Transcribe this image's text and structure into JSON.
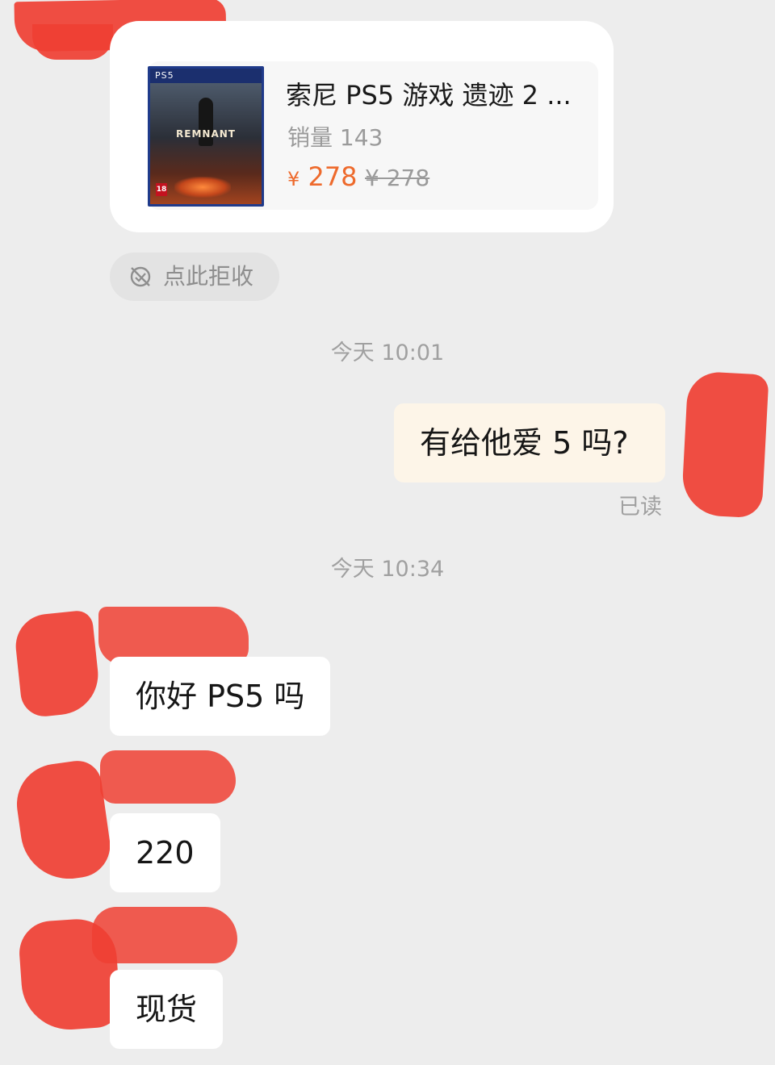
{
  "product": {
    "title": "索尼 PS5 游戏 遗迹 2 ...",
    "sales": "销量 143",
    "currency": "¥",
    "price": "278",
    "original_price": "¥ 278",
    "cover": {
      "platform": "PS5",
      "game": "REMNANT",
      "age_rating": "18"
    }
  },
  "refuse": {
    "label": "点此拒收"
  },
  "timestamps": [
    "今天 10:01",
    "今天 10:34"
  ],
  "messages": [
    {
      "side": "self",
      "text": "有给他爱 5 吗?",
      "status": "已读"
    },
    {
      "side": "other",
      "text": "你好 PS5 吗"
    },
    {
      "side": "other",
      "text": "220"
    },
    {
      "side": "other",
      "text": "现货"
    }
  ],
  "colors": {
    "background": "#ededed",
    "price": "#ee6a2c",
    "self_bubble": "#fdf5e8",
    "other_bubble": "#ffffff",
    "redaction": "#ef3f33"
  }
}
